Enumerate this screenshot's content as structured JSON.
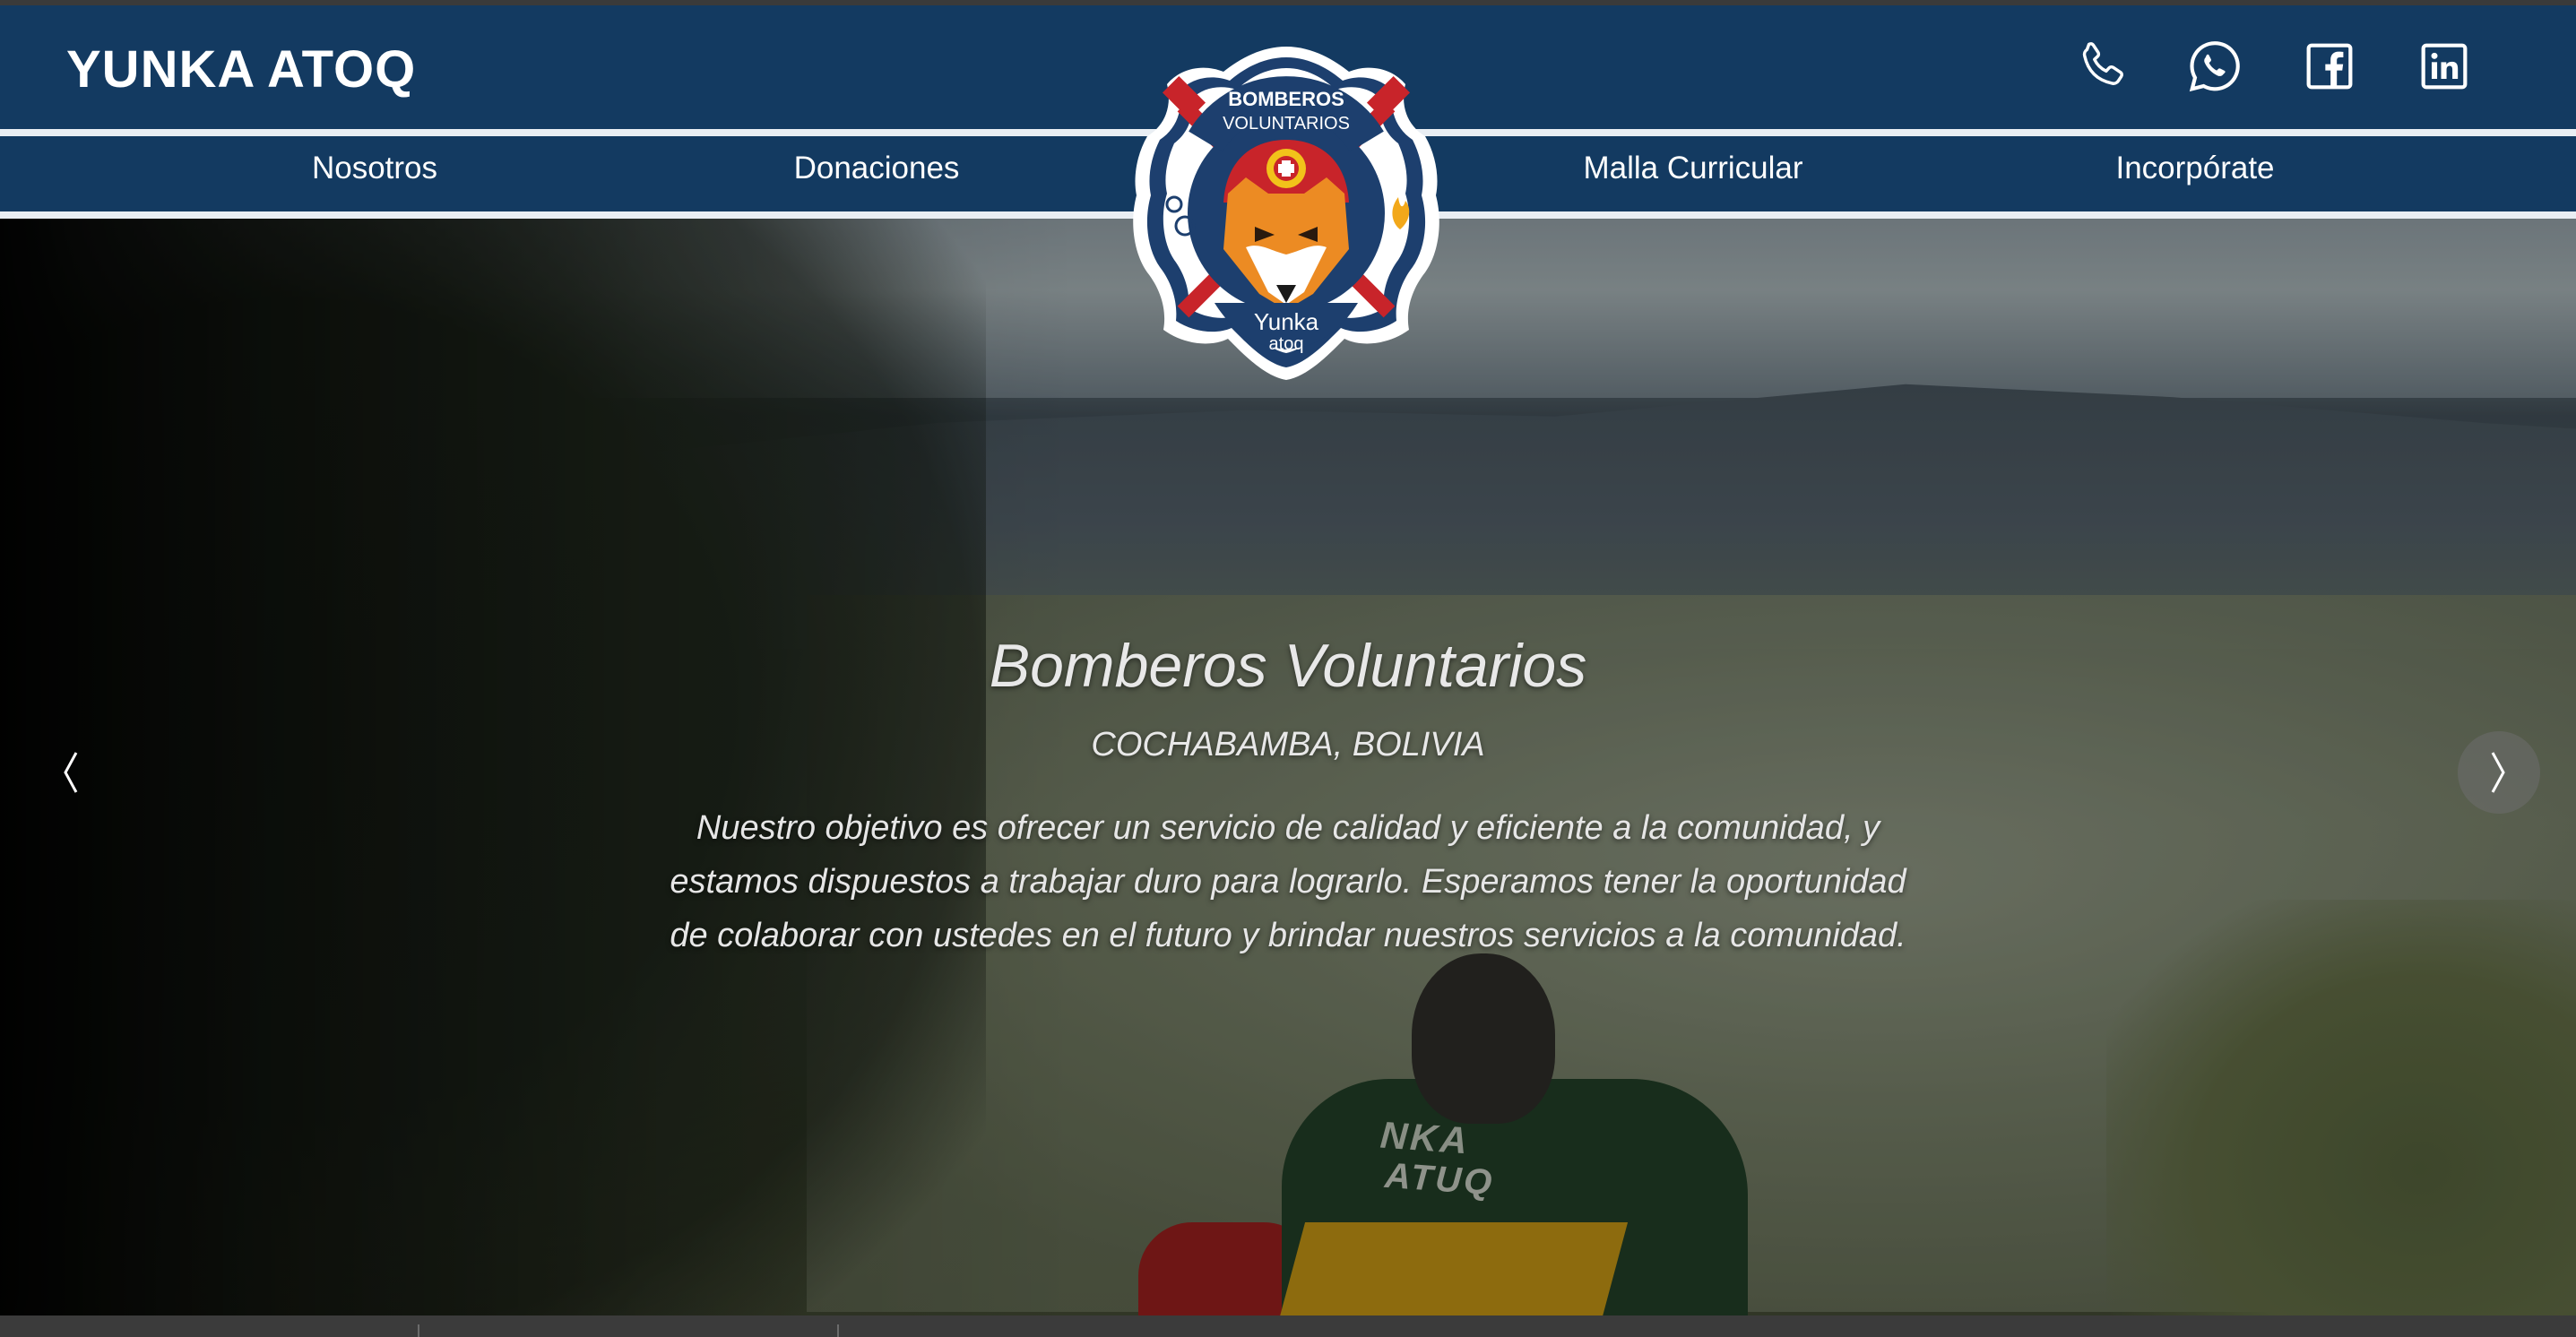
{
  "header": {
    "brand": "YUNKA ATOQ",
    "social": [
      {
        "name": "phone",
        "icon": "phone-icon"
      },
      {
        "name": "whatsapp",
        "icon": "whatsapp-icon"
      },
      {
        "name": "facebook",
        "icon": "facebook-icon"
      },
      {
        "name": "linkedin",
        "icon": "linkedin-icon"
      }
    ]
  },
  "nav": {
    "items": [
      {
        "label": "Nosotros"
      },
      {
        "label": "Donaciones"
      },
      {
        "label": "Malla Curricular"
      },
      {
        "label": "Incorpórate"
      }
    ]
  },
  "logo": {
    "top_text": "BOMBEROS",
    "arc_text": "VOLUNTARIOS",
    "name_line1": "Yunka",
    "name_line2": "atoq"
  },
  "hero": {
    "title": "Bomberos Voluntarios",
    "subtitle": "COCHABAMBA, BOLIVIA",
    "body": "Nuestro objetivo es ofrecer un servicio de calidad y eficiente a la comunidad, y estamos dispuestos a trabajar duro para lograrlo. Esperamos tener la oportunidad de colaborar con ustedes en el futuro y brindar nuestros servicios a la comunidad.",
    "jacket_text_1": "NKA",
    "jacket_text_2": "ATUQ"
  },
  "carousel": {
    "prev_icon": "chevron-left-icon",
    "next_icon": "chevron-right-icon"
  },
  "colors": {
    "header_bg": "#133a61",
    "divider": "#e9eef3",
    "text_light": "#ffffff"
  }
}
